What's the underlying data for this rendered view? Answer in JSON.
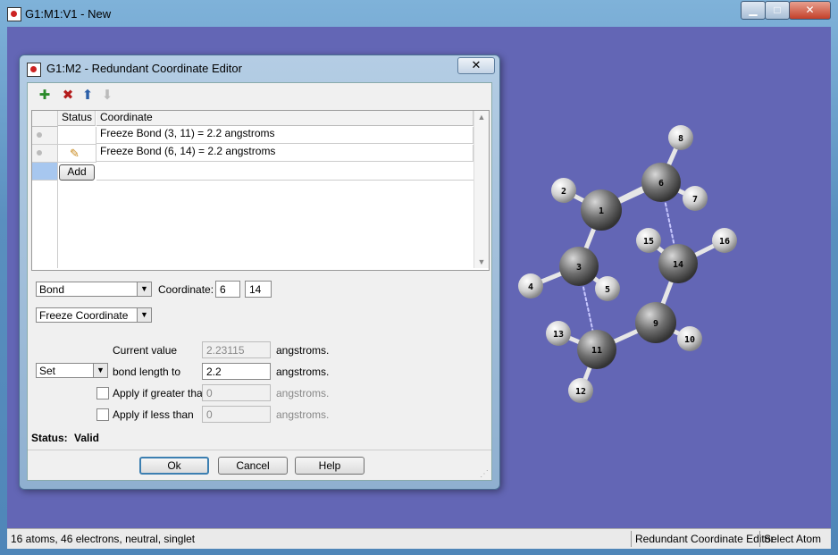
{
  "window": {
    "title": "G1:M1:V1 - New",
    "buttons": {
      "minimize": "▁",
      "maximize": "□",
      "close": "✕"
    }
  },
  "molecule": {
    "atoms": [
      "1",
      "2",
      "3",
      "4",
      "5",
      "6",
      "7",
      "8",
      "9",
      "10",
      "11",
      "12",
      "13",
      "14",
      "15",
      "16"
    ]
  },
  "status_bar": {
    "info": "16 atoms, 46 electrons, neutral, singlet",
    "mode": "Redundant Coordinate Editor",
    "action": "Select Atom"
  },
  "dialog": {
    "title": "G1:M2 - Redundant Coordinate Editor",
    "close_label": "✕",
    "table": {
      "headers": {
        "status": "Status",
        "coordinate": "Coordinate"
      },
      "rows": [
        {
          "coordinate": "Freeze Bond (3, 11) = 2.2 angstroms"
        },
        {
          "coordinate": "Freeze Bond (6, 14) = 2.2 angstroms"
        }
      ],
      "add_label": "Add"
    },
    "type_select": "Bond",
    "coordinate_label": "Coordinate:",
    "coord_a": "6",
    "coord_b": "14",
    "action_select": "Freeze Coordinate",
    "current_value_label": "Current value",
    "current_value": "2.23115",
    "units": "angstroms.",
    "set_select": "Set",
    "set_label": "bond length to",
    "set_value": "2.2",
    "greater_label": "Apply if greater than",
    "greater_value": "0",
    "less_label": "Apply if less than",
    "less_value": "0",
    "status_label": "Status:",
    "status_value": "Valid",
    "buttons": {
      "ok": "Ok",
      "cancel": "Cancel",
      "help": "Help"
    }
  }
}
